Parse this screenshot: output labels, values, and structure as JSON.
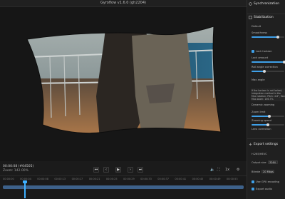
{
  "app": {
    "title": "Gyroflow v1.6.0 (gh2204)",
    "window_controls": [
      "minimize-icon",
      "maximize-icon",
      "close-icon"
    ]
  },
  "player": {
    "timecode": "00:00:08 (#04505)",
    "zoom": "Zoom: 142.00%",
    "controls": [
      {
        "name": "prev-frame-button",
        "glyph": "⏮"
      },
      {
        "name": "step-back-button",
        "glyph": "‹"
      },
      {
        "name": "play-button",
        "glyph": "▶"
      },
      {
        "name": "step-forward-button",
        "glyph": "›"
      },
      {
        "name": "next-frame-button",
        "glyph": "⏭"
      }
    ],
    "right_controls": {
      "volume_label": "1x"
    }
  },
  "timeline": {
    "ticks": [
      "00:00:00",
      "00:00:04",
      "00:00:08",
      "00:00:13",
      "00:00:17",
      "00:00:21",
      "00:00:25",
      "00:00:29",
      "00:00:33",
      "00:00:37",
      "00:00:41",
      "00:00:45",
      "00:00:49",
      "00:00:53"
    ],
    "playhead_fraction": 0.09,
    "fill_fraction": 1.0
  },
  "panel": {
    "synchronization": {
      "title": "Synchronization"
    },
    "stabilization": {
      "title": "Stabilization",
      "preset_label": "Default",
      "smoothness_label": "Smoothness",
      "smoothness_fraction": 0.8,
      "lock_horizon_label": "Lock horizon",
      "lock_amount_label": "Lock amount",
      "lock_amount_fraction": 1.0,
      "roll_angle_label": "Roll angle correction",
      "roll_angle_fraction": 0.4,
      "max_angle_label": "Max angle",
      "info_lines": [
        "If the horizon is not locked,",
        "integration method in the",
        "Max rotation: Pitch: 4.8°, Yaw:",
        "Max zoom: 156.7%"
      ],
      "dynamic_zooming_label": "Dynamic zooming",
      "zoom_limit_label": "Zoom limit",
      "zoom_limit_fraction": 0.55,
      "zooming_speed_label": "Zooming speed",
      "zooming_speed_fraction": 0.5,
      "lens_correction_label": "Lens correction"
    },
    "export": {
      "title": "Export settings",
      "codec": "H.265/HEVC",
      "output_size_label": "Output size",
      "output_size_value": "3264",
      "bitrate_label": "Bitrate",
      "bitrate_value": "20 Mbps",
      "gpu_label": "Use GPU encoding",
      "audio_label": "Export audio"
    }
  },
  "colors": {
    "accent": "#3fa0e8",
    "background": "#1b1b1b",
    "panel": "#202020"
  }
}
